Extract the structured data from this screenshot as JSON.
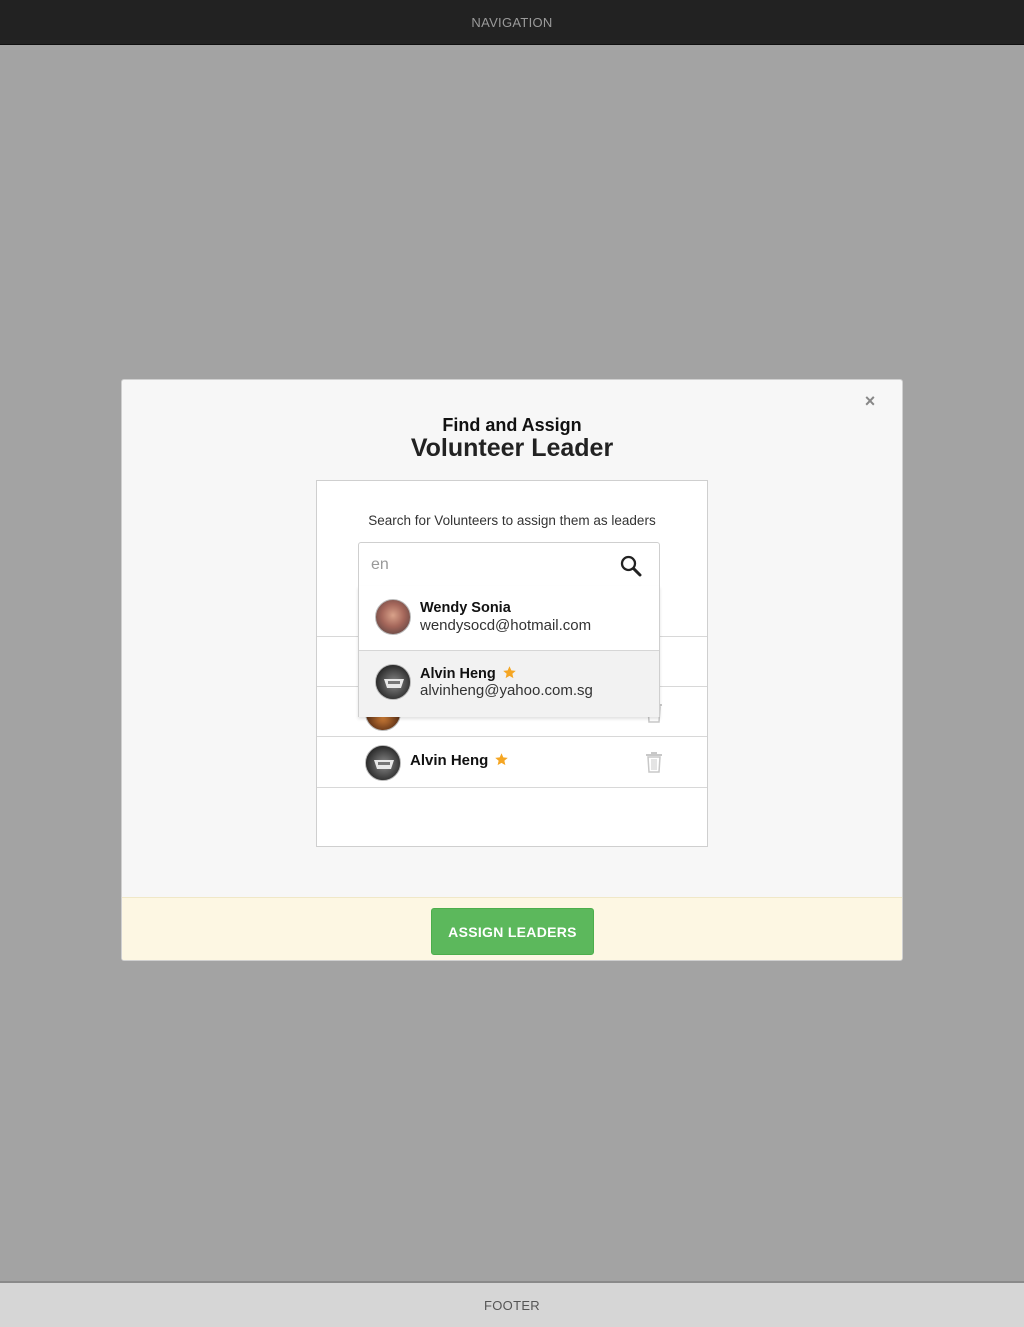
{
  "nav": {
    "label": "NAVIGATION"
  },
  "footer": {
    "label": "FOOTER"
  },
  "modal": {
    "close_glyph": "×",
    "title_small": "Find and Assign",
    "title_large": "Volunteer Leader",
    "hint": "Search for Volunteers to assign them as leaders",
    "search": {
      "value": "en",
      "placeholder": ""
    },
    "suggestions": [
      {
        "name": "Wendy Sonia",
        "email": "wendysocd@hotmail.com",
        "starred": false,
        "icon": "user-photo"
      },
      {
        "name": "Alvin Heng",
        "email": "alvinheng@yahoo.com.sg",
        "starred": true,
        "icon": "user-photo"
      }
    ],
    "leaders": [
      {
        "name": "Alvin Heng",
        "starred": true,
        "icon": "user-photo"
      }
    ],
    "assign_label": "ASSIGN LEADERS"
  },
  "colors": {
    "overlay": "#a3a3a3",
    "nav_bg": "#222222",
    "accent_green": "#5cb85c",
    "star": "#f5a623",
    "footer_bar": "#fdf7e3"
  }
}
